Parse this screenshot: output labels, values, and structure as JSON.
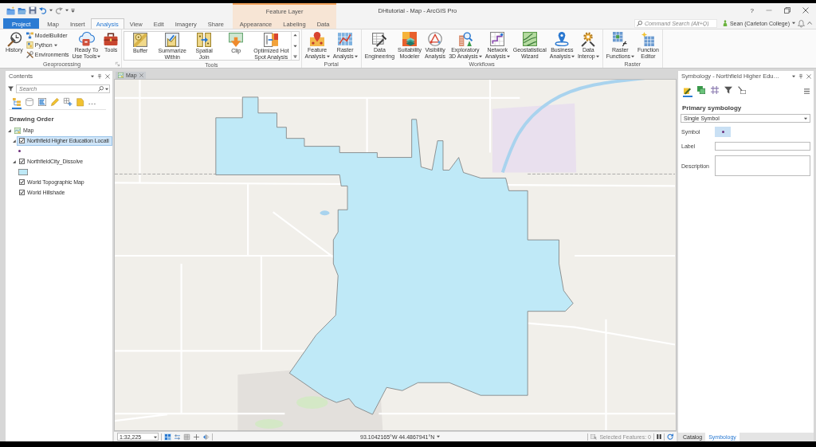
{
  "title_bar": {
    "contextual_header": "Feature Layer",
    "title": "DHtutorial - Map - ArcGIS Pro",
    "help": "?"
  },
  "tabs": [
    {
      "label": "Project",
      "kind": "file",
      "selected": false
    },
    {
      "label": "Map",
      "kind": "core",
      "selected": false
    },
    {
      "label": "Insert",
      "kind": "core",
      "selected": false
    },
    {
      "label": "Analysis",
      "kind": "core",
      "selected": true
    },
    {
      "label": "View",
      "kind": "core",
      "selected": false
    },
    {
      "label": "Edit",
      "kind": "core",
      "selected": false
    },
    {
      "label": "Imagery",
      "kind": "core",
      "selected": false
    },
    {
      "label": "Share",
      "kind": "core",
      "selected": false
    },
    {
      "label": "Appearance",
      "kind": "contextual",
      "selected": false
    },
    {
      "label": "Labeling",
      "kind": "contextual",
      "selected": false
    },
    {
      "label": "Data",
      "kind": "contextual",
      "selected": false
    }
  ],
  "command_search": {
    "placeholder": "Command Search (Alt+Q)"
  },
  "account": {
    "name": "Sean (Carleton College)",
    "dropdown": true
  },
  "ribbon": [
    {
      "title": "Geoprocessing",
      "kind": "buttons",
      "launcher": true,
      "items": [
        {
          "kind": "large",
          "lines": [
            "History"
          ],
          "dropdown": false
        },
        {
          "kind": "stack",
          "items": [
            {
              "label": "ModelBuilder",
              "dropdown": false
            },
            {
              "label": "Python",
              "dropdown": true
            },
            {
              "label": "Environments",
              "dropdown": false
            }
          ]
        },
        {
          "kind": "large",
          "lines": [
            "Ready To",
            "Use Tools"
          ],
          "dropdown": true
        },
        {
          "kind": "large",
          "lines": [
            "Tools"
          ],
          "dropdown": false
        }
      ]
    },
    {
      "title": "Tools",
      "kind": "gallery",
      "launcher": false,
      "items": [
        {
          "kind": "large",
          "lines": [
            "Buffer"
          ],
          "dropdown": false
        },
        {
          "kind": "large",
          "lines": [
            "Summarize",
            "Within"
          ],
          "dropdown": false
        },
        {
          "kind": "large",
          "lines": [
            "Spatial",
            "Join"
          ],
          "dropdown": false
        },
        {
          "kind": "large",
          "lines": [
            "Clip"
          ],
          "dropdown": false
        },
        {
          "kind": "large",
          "lines": [
            "Optimized Hot",
            "Spot Analysis"
          ],
          "dropdown": false
        }
      ]
    },
    {
      "title": "Portal",
      "kind": "buttons",
      "launcher": false,
      "items": [
        {
          "kind": "large",
          "lines": [
            "Feature",
            "Analysis"
          ],
          "dropdown": true
        },
        {
          "kind": "large",
          "lines": [
            "Raster",
            "Analysis"
          ],
          "dropdown": true
        }
      ]
    },
    {
      "title": "Workflows",
      "kind": "buttons",
      "launcher": false,
      "items": [
        {
          "kind": "large",
          "lines": [
            "Data",
            "Engineering"
          ],
          "dropdown": false
        },
        {
          "kind": "large",
          "lines": [
            "Suitability",
            "Modeler"
          ],
          "dropdown": false
        },
        {
          "kind": "large",
          "lines": [
            "Visibility",
            "Analysis"
          ],
          "dropdown": false
        },
        {
          "kind": "large",
          "lines": [
            "Exploratory",
            "3D Analysis"
          ],
          "dropdown": true
        },
        {
          "kind": "large",
          "lines": [
            "Network",
            "Analysis"
          ],
          "dropdown": true
        },
        {
          "kind": "large",
          "lines": [
            "Geostatistical",
            "Wizard"
          ],
          "dropdown": false
        },
        {
          "kind": "large",
          "lines": [
            "Business",
            "Analysis"
          ],
          "dropdown": true
        },
        {
          "kind": "large",
          "lines": [
            "Data",
            "Interop"
          ],
          "dropdown": true
        }
      ]
    },
    {
      "title": "Raster",
      "kind": "buttons",
      "launcher": false,
      "items": [
        {
          "kind": "large",
          "lines": [
            "Raster",
            "Functions"
          ],
          "dropdown": true
        },
        {
          "kind": "large",
          "lines": [
            "Function",
            "Editor"
          ],
          "dropdown": false
        }
      ]
    }
  ],
  "contents": {
    "title": "Contents",
    "search": {
      "placeholder": "Search"
    },
    "views": [
      {
        "selected": true
      },
      {
        "selected": false
      },
      {
        "selected": false
      },
      {
        "selected": false
      },
      {
        "selected": false
      },
      {
        "selected": false
      }
    ],
    "heading": "Drawing Order",
    "layers": [
      {
        "label": "Map",
        "kind": "map",
        "selected": false,
        "expanded": true,
        "children": [
          {
            "label": "Northfield Higher Education Locati",
            "kind": "layer",
            "checked": true,
            "selected": true,
            "expanded": true,
            "legend": {
              "kind": "point"
            }
          },
          {
            "label": "NorthfieldCity_Dissolve",
            "kind": "layer",
            "checked": true,
            "selected": false,
            "expanded": true,
            "legend": {
              "kind": "polygon"
            }
          },
          {
            "label": "World Topographic Map",
            "kind": "layer",
            "checked": true,
            "selected": false
          },
          {
            "label": "World Hillshade",
            "kind": "layer",
            "checked": true,
            "selected": false
          }
        ]
      }
    ]
  },
  "map_view": {
    "tab": "Map",
    "status": {
      "scale": "1:32,225",
      "tools": [
        {
          "selected": true
        },
        {
          "selected": false
        },
        {
          "selected": false
        },
        {
          "selected": false
        },
        {
          "selected": false
        }
      ],
      "coordinates": "93.1042165°W 44.4867941°N",
      "selected_features": "Selected Features: 0"
    }
  },
  "symbology": {
    "title": "Symbology - Northfield Higher Edu…",
    "views": [
      {
        "selected": true
      },
      {
        "selected": false
      },
      {
        "selected": false
      },
      {
        "selected": false
      },
      {
        "selected": false
      }
    ],
    "heading": "Primary symbology",
    "method": "Single Symbol",
    "fields": [
      {
        "label": "Symbol",
        "kind": "symbol"
      },
      {
        "label": "Label",
        "kind": "text"
      },
      {
        "label": "Description",
        "kind": "textarea"
      }
    ]
  },
  "dock_tabs": [
    {
      "label": "Catalog",
      "selected": false
    },
    {
      "label": "Symbology",
      "selected": true
    }
  ]
}
